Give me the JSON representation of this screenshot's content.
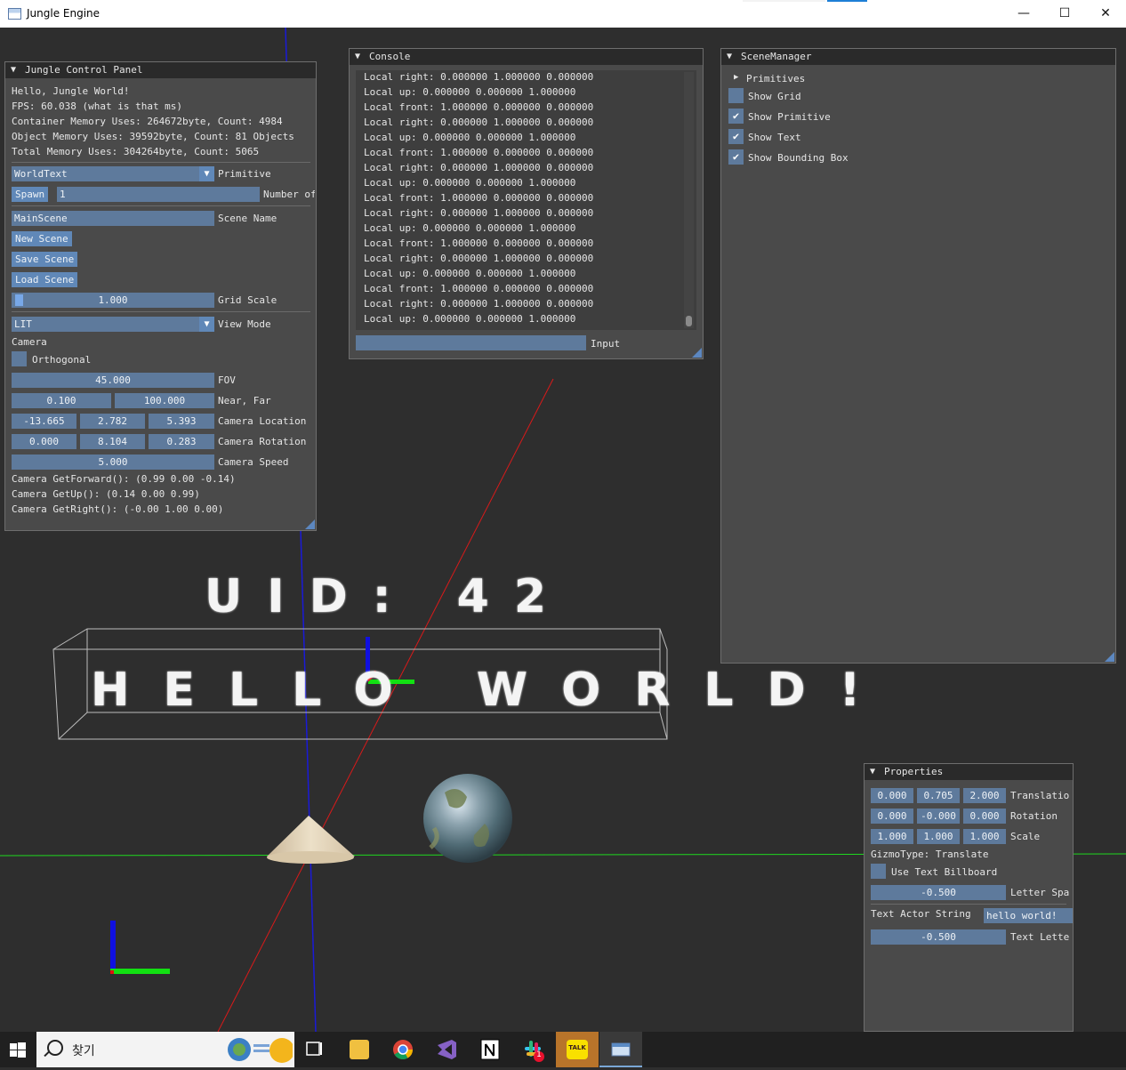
{
  "window": {
    "title": "Jungle Engine",
    "minimize": "—",
    "maximize": "☐",
    "close": "✕"
  },
  "scene": {
    "uid_text": "UID: 42",
    "world_text": "HELLO WORLD!"
  },
  "control_panel": {
    "title": "Jungle Control Panel",
    "hello": "Hello, Jungle World!",
    "fps": "FPS: 60.038 (what is that ms)",
    "container_mem": "Container Memory Uses: 264672byte, Count: 4984",
    "object_mem": "Object Memory Uses: 39592byte, Count: 81 Objects",
    "total_mem": "Total Memory Uses: 304264byte, Count: 5065",
    "primitive_value": "WorldText",
    "primitive_label": "Primitive",
    "spawn_label": "Spawn",
    "spawn_count": "1",
    "spawn_count_label": "Number of",
    "scene_name_value": "MainScene",
    "scene_name_label": "Scene Name",
    "new_scene": "New Scene",
    "save_scene": "Save Scene",
    "load_scene": "Load Scene",
    "grid_scale_value": "1.000",
    "grid_scale_label": "Grid Scale",
    "view_mode_value": "LIT",
    "view_mode_label": "View Mode",
    "camera_header": "Camera",
    "orthogonal_label": "Orthogonal",
    "orthogonal_checked": false,
    "fov_value": "45.000",
    "fov_label": "FOV",
    "near_value": "0.100",
    "far_value": "100.000",
    "near_far_label": "Near, Far",
    "loc_x": "-13.665",
    "loc_y": "2.782",
    "loc_z": "5.393",
    "loc_label": "Camera Location",
    "rot_x": "0.000",
    "rot_y": "8.104",
    "rot_z": "0.283",
    "rot_label": "Camera Rotation",
    "speed_value": "5.000",
    "speed_label": "Camera Speed",
    "forward": "Camera GetForward(): (0.99 0.00 -0.14)",
    "up": "Camera GetUp(): (0.14 0.00 0.99)",
    "right": "Camera GetRight(): (-0.00 1.00 0.00)"
  },
  "console": {
    "title": "Console",
    "lines": [
      "Local right: 0.000000 1.000000 0.000000",
      "Local up: 0.000000 0.000000 1.000000",
      "Local front: 1.000000 0.000000 0.000000",
      "Local right: 0.000000 1.000000 0.000000",
      "Local up: 0.000000 0.000000 1.000000",
      "Local front: 1.000000 0.000000 0.000000",
      "Local right: 0.000000 1.000000 0.000000",
      "Local up: 0.000000 0.000000 1.000000",
      "Local front: 1.000000 0.000000 0.000000",
      "Local right: 0.000000 1.000000 0.000000",
      "Local up: 0.000000 0.000000 1.000000",
      "Local front: 1.000000 0.000000 0.000000",
      "Local right: 0.000000 1.000000 0.000000",
      "Local up: 0.000000 0.000000 1.000000",
      "Local front: 1.000000 0.000000 0.000000",
      "Local right: 0.000000 1.000000 0.000000",
      "Local up: 0.000000 0.000000 1.000000"
    ],
    "input_value": "",
    "input_label": "Input"
  },
  "scene_manager": {
    "title": "SceneManager",
    "primitives": "Primitives",
    "items": [
      {
        "label": "Show Grid",
        "checked": false
      },
      {
        "label": "Show Primitive",
        "checked": true
      },
      {
        "label": "Show Text",
        "checked": true
      },
      {
        "label": "Show Bounding Box",
        "checked": true
      }
    ]
  },
  "properties": {
    "title": "Properties",
    "translation": [
      "0.000",
      "0.705",
      "2.000"
    ],
    "translation_label": "Translatio",
    "rotation": [
      "0.000",
      "-0.000",
      "0.000"
    ],
    "rotation_label": "Rotation",
    "scale": [
      "1.000",
      "1.000",
      "1.000"
    ],
    "scale_label": "Scale",
    "gizmo_type": "GizmoType: Translate",
    "billboard_label": "Use Text Billboard",
    "billboard_checked": false,
    "letter_spacing_value": "-0.500",
    "letter_spacing_label": "Letter Spa",
    "text_string_label": "Text Actor String",
    "text_string_value": "hello world!",
    "text_letter_value": "-0.500",
    "text_letter_label": "Text Lette"
  },
  "taskbar": {
    "search_placeholder": "찾기",
    "apps": [
      "windows-start-icon",
      "task-view-icon",
      "file-explorer-icon",
      "chrome-icon",
      "visual-studio-icon",
      "notion-icon",
      "slack-icon",
      "kakaotalk-icon",
      "jungle-engine-icon"
    ],
    "slack_badge": "1",
    "kakao_label": "TALK"
  },
  "colors": {
    "panel_bg": "#4a4a4a",
    "field": "#5e7a9c",
    "button": "#6088b8",
    "header": "#2a2a2a",
    "viewport": "#2e2e2e"
  }
}
